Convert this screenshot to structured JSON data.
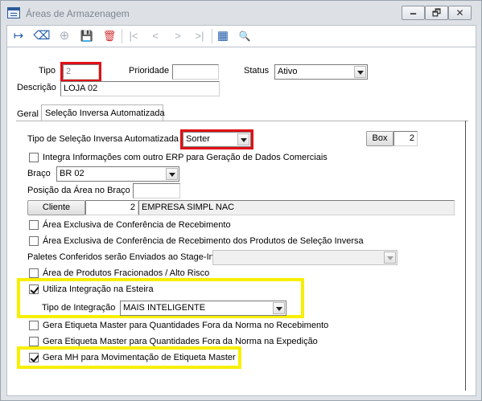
{
  "window": {
    "title": "Áreas de Armazenagem",
    "minimize_glyph": "🗕",
    "maximize_glyph": "🗗",
    "close_glyph": "✕"
  },
  "toolbar": {
    "icons": [
      "exit-icon",
      "eraser-icon",
      "add-circle-icon",
      "save-icon",
      "delete-icon",
      "first-record-icon",
      "previous-record-icon",
      "next-record-icon",
      "last-record-icon",
      "grid-icon",
      "search-icon"
    ],
    "glyphs": {
      "exit": "↦",
      "eraser": "⌫",
      "add": "⊕",
      "save": "💾",
      "delete": "🗑",
      "first": "|<",
      "previous": "<",
      "next": ">",
      "last": ">|",
      "grid": "▦",
      "search": "🔍"
    }
  },
  "form": {
    "tipo_label": "Tipo",
    "tipo_value": "2",
    "prioridade_label": "Prioridade",
    "prioridade_value": "",
    "status_label": "Status",
    "status_value": "Ativo",
    "descricao_label": "Descrição",
    "descricao_value": "LOJA 02"
  },
  "tabs": {
    "geral": "Geral",
    "selecao": "Seleção Inversa Automatizada"
  },
  "panel": {
    "tipo_selecao_label": "Tipo de Seleção Inversa Automatizada",
    "tipo_selecao_value": "Sorter",
    "box_button": "Box",
    "box_value": "2",
    "integra_erp_label": "Integra Informações com outro ERP para Geração de Dados Comerciais",
    "integra_erp_checked": false,
    "braco_label": "Braço",
    "braco_value": "BR 02",
    "posicao_label": "Posição da Área no Braço",
    "posicao_value": "",
    "cliente_button": "Cliente",
    "cliente_code": "2",
    "cliente_name": "EMPRESA SIMPL NAC",
    "area_conf_receb_label": "Área Exclusiva de Conferência de Recebimento",
    "area_conf_receb_checked": false,
    "area_conf_prod_label": "Área Exclusiva de Conferência de Recebimento dos Produtos de Seleção Inversa",
    "area_conf_prod_checked": false,
    "paletes_label": "Paletes Conferidos serão Enviados ao Stage-In",
    "paletes_value": "",
    "area_fracionados_label": "Área de Produtos Fracionados / Alto Risco",
    "area_fracionados_checked": false,
    "utiliza_esteira_label": "Utiliza Integração na Esteira",
    "utiliza_esteira_checked": true,
    "tipo_integracao_label": "Tipo de Integração",
    "tipo_integracao_value": "MAIS INTELIGENTE",
    "gera_etiqueta_receb_label": "Gera Etiqueta Master para Quantidades Fora da Norma no Recebimento",
    "gera_etiqueta_receb_checked": false,
    "gera_etiqueta_exped_label": "Gera Etiqueta Master para Quantidades Fora da Norma na Expedição",
    "gera_etiqueta_exped_checked": false,
    "gera_mh_label": "Gera MH para Movimentação de Etiqueta Master",
    "gera_mh_checked": true
  },
  "colors": {
    "highlight_red": "#e01016",
    "highlight_yellow": "#f7ef00",
    "window_bg": "#dfe3e8"
  }
}
